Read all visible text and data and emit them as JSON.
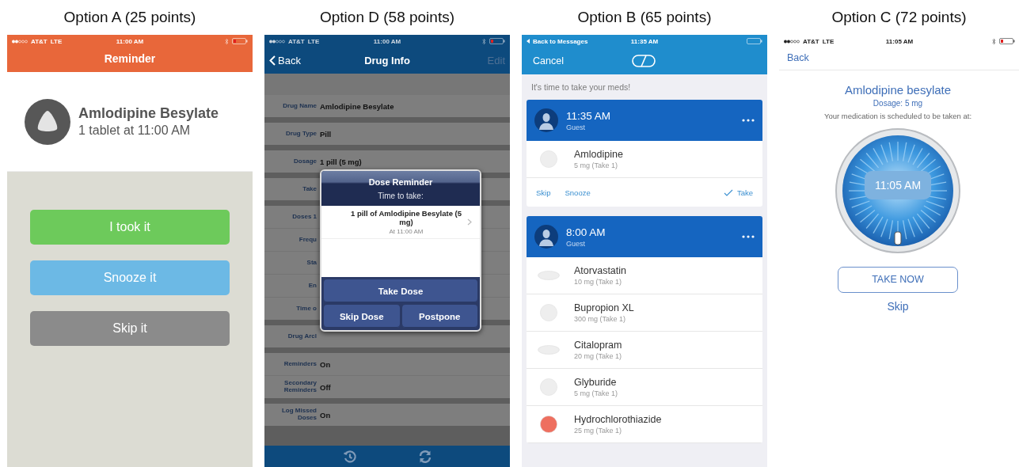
{
  "panels": [
    {
      "kind": "reminder",
      "caption": "Option A (25 points)",
      "status": {
        "carrier": "AT&T",
        "network": "LTE",
        "time": "11:00 AM",
        "bluetooth": true,
        "battery_low": true
      },
      "title": "Reminder",
      "drug": {
        "name": "Amlodipine Besylate",
        "schedule": "1 tablet at 11:00 AM"
      },
      "buttons": [
        {
          "label": "I took it",
          "color": "#6dca5b"
        },
        {
          "label": "Snooze it",
          "color": "#6cb9e5"
        },
        {
          "label": "Skip it",
          "color": "#8b8b8b"
        }
      ]
    },
    {
      "kind": "drug_info",
      "caption": "Option D (58 points)",
      "status": {
        "carrier": "AT&T",
        "network": "LTE",
        "time": "11:00 AM",
        "bluetooth": true,
        "battery_low": true
      },
      "nav": {
        "back": "Back",
        "title": "Drug Info",
        "edit": "Edit",
        "edit_disabled": true
      },
      "groups": [
        [
          {
            "label": "Drug Name",
            "value": "Amlodipine Besylate"
          }
        ],
        [
          {
            "label": "Drug Type",
            "value": "Pill"
          }
        ],
        [
          {
            "label": "Dosage",
            "value": "1 pill (5 mg)"
          }
        ],
        [
          {
            "label": "Take"
          }
        ],
        [
          {
            "label": "Doses 1"
          },
          {
            "label": "Frequ"
          },
          {
            "label": "Sta"
          },
          {
            "label": "En"
          },
          {
            "label": "Time o"
          }
        ],
        [
          {
            "label": "Drug Arcl"
          }
        ],
        [
          {
            "label": "Reminders",
            "value": "On"
          },
          {
            "label": "Secondary Reminders",
            "value": "Off"
          }
        ],
        [
          {
            "label": "Log Missed Doses",
            "value": "On"
          }
        ]
      ],
      "dialog": {
        "title": "Dose Reminder",
        "subtitle": "Time to take:",
        "item": "1 pill of Amlodipine Besylate (5 mg)",
        "time": "At 11:00 AM",
        "primary": "Take Dose",
        "secondary": [
          "Skip Dose",
          "Postpone"
        ]
      }
    },
    {
      "kind": "med_list",
      "caption": "Option B (65 points)",
      "status": {
        "back": "Back to Messages",
        "time": "11:35 AM",
        "bluetooth": false,
        "battery_low": false
      },
      "nav": {
        "cancel": "Cancel"
      },
      "intro": "It's time to take your meds!",
      "cards": [
        {
          "time": "11:35 AM",
          "user": "Guest",
          "meds": [
            {
              "name": "Amlodipine",
              "dose": "5 mg (Take 1)",
              "kind": "round",
              "color": "#eeeeee"
            }
          ],
          "actions": {
            "skip": "Skip",
            "snooze": "Snooze",
            "take": "Take"
          }
        },
        {
          "time": "8:00 AM",
          "user": "Guest",
          "meds": [
            {
              "name": "Atorvastatin",
              "dose": "10 mg (Take 1)",
              "kind": "oval",
              "color": "#eeeeee"
            },
            {
              "name": "Bupropion XL",
              "dose": "300 mg (Take 1)",
              "kind": "round",
              "color": "#eeeeee"
            },
            {
              "name": "Citalopram",
              "dose": "20 mg (Take 1)",
              "kind": "oval",
              "color": "#eeeeee"
            },
            {
              "name": "Glyburide",
              "dose": "5 mg (Take 1)",
              "kind": "round",
              "color": "#eeeeee"
            },
            {
              "name": "Hydrochlorothiazide",
              "dose": "25 mg (Take 1)",
              "kind": "round",
              "color": "#ee6f5f"
            }
          ]
        }
      ]
    },
    {
      "kind": "dispenser",
      "caption": "Option C (72 points)",
      "status": {
        "carrier": "AT&T",
        "network": "LTE",
        "time": "11:05 AM",
        "bluetooth": true,
        "battery_low": true
      },
      "back": "Back",
      "drug_name": "Amlodipine besylate",
      "dosage": "Dosage: 5 mg",
      "message": "Your medication is scheduled to be taken at:",
      "time": "11:05 AM",
      "take_button": "TAKE NOW",
      "skip": "Skip"
    }
  ]
}
